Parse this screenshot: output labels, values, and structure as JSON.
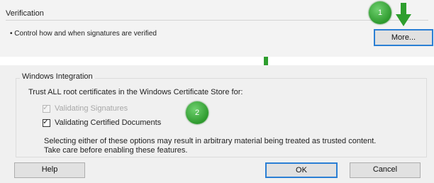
{
  "verification": {
    "title": "Verification",
    "description": "• Control how and when signatures are verified",
    "more_label": "More..."
  },
  "annotations": {
    "step1": "1",
    "step2": "2",
    "color": "#3aa83a"
  },
  "windows_integration": {
    "title": "Windows Integration",
    "trust_text": "Trust ALL root certificates in the Windows Certificate Store for:",
    "options": [
      {
        "label": "Validating Signatures",
        "checked": true,
        "disabled": true
      },
      {
        "label": "Validating Certified Documents",
        "checked": true,
        "disabled": false
      }
    ],
    "warning_line1": "Selecting either of these options may result in arbitrary material being treated as trusted content.",
    "warning_line2": "Take care before enabling these features."
  },
  "buttons": {
    "help": "Help",
    "ok": "OK",
    "cancel": "Cancel"
  }
}
